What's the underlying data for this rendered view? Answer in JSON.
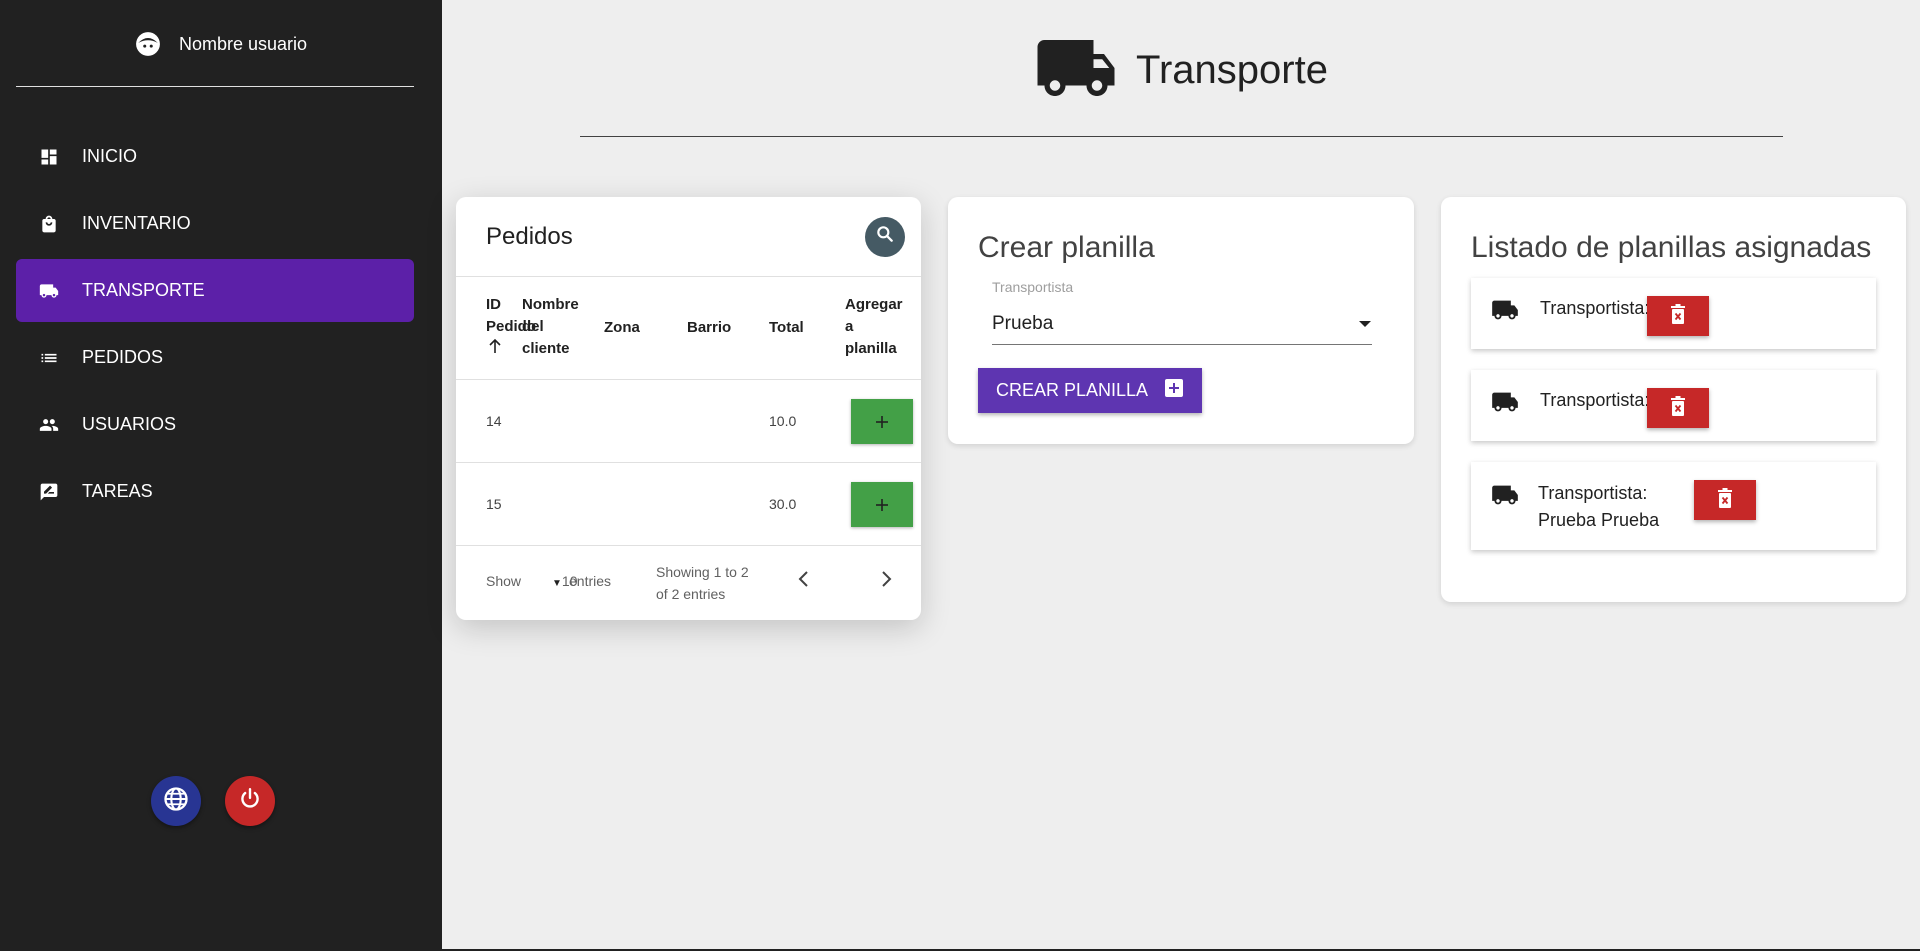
{
  "sidebar": {
    "user_name": "Nombre usuario",
    "items": [
      {
        "label": "INICIO",
        "icon": "dashboard-icon"
      },
      {
        "label": "INVENTARIO",
        "icon": "shopping-bag-icon"
      },
      {
        "label": "TRANSPORTE",
        "icon": "truck-icon",
        "active": true
      },
      {
        "label": "PEDIDOS",
        "icon": "list-icon"
      },
      {
        "label": "USUARIOS",
        "icon": "users-icon"
      },
      {
        "label": "TAREAS",
        "icon": "task-icon"
      }
    ]
  },
  "header": {
    "title": "Transporte"
  },
  "pedidos": {
    "title": "Pedidos",
    "columns": {
      "id_line1": "ID",
      "id_line2": "Pedido",
      "nombre_line1": "Nombre",
      "nombre_line2": "del",
      "nombre_line3": "cliente",
      "zona": "Zona",
      "barrio": "Barrio",
      "total": "Total",
      "agregar_line1": "Agregar",
      "agregar_line2": "a",
      "agregar_line3": "planilla"
    },
    "rows": [
      {
        "id": "14",
        "nombre": "",
        "zona": "",
        "barrio": "",
        "total": "10.0"
      },
      {
        "id": "15",
        "nombre": "",
        "zona": "",
        "barrio": "",
        "total": "30.0"
      }
    ],
    "footer": {
      "show": "Show",
      "entries_value": "10",
      "entries": "entries",
      "info": "Showing 1 to 2 of 2 entries"
    }
  },
  "crear": {
    "title": "Crear planilla",
    "select_label": "Transportista",
    "select_value": "Prueba",
    "button_label": "CREAR PLANILLA"
  },
  "listado": {
    "title": "Listado de planillas asignadas",
    "items": [
      {
        "label": "Transportista:"
      },
      {
        "label": "Transportista:"
      },
      {
        "label_line1": "Transportista:",
        "label_line2": "Prueba Prueba"
      }
    ]
  },
  "colors": {
    "sidebar_bg": "#212121",
    "active_nav": "#5c20a8",
    "primary_button": "#5e35b1",
    "add_button": "#43a047",
    "delete_button": "#c62828",
    "search_button": "#455a64",
    "lang_button": "#283593",
    "power_button": "#c62828"
  }
}
